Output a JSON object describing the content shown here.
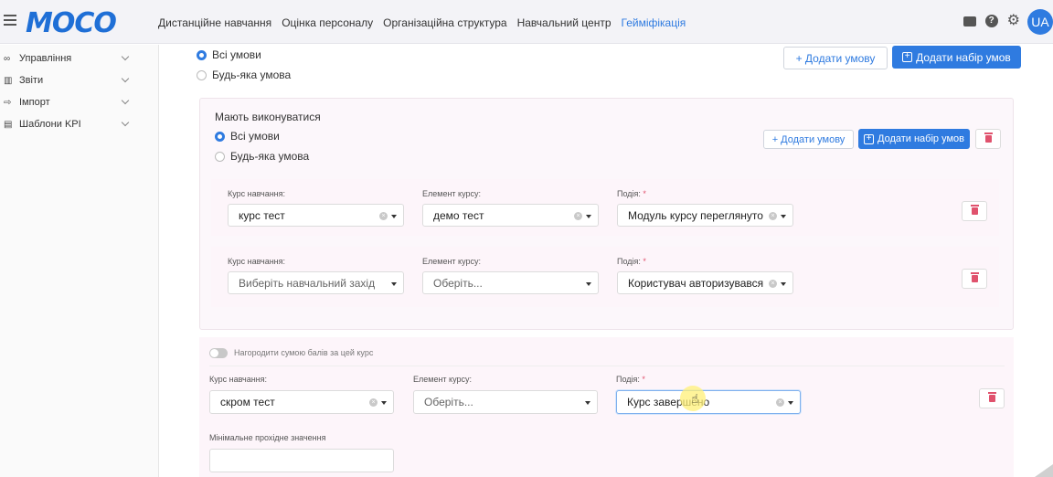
{
  "header": {
    "logo": "MOCO",
    "nav": [
      "Дистанційне навчання",
      "Оцінка персоналу",
      "Організаційна структура",
      "Навчальний центр",
      "Геймiфікація"
    ],
    "nav_active": 4,
    "avatar": "UA"
  },
  "sidebar": {
    "items": [
      {
        "label": "Управління",
        "icon": "glasses-icon"
      },
      {
        "label": "Звіти",
        "icon": "chart-icon"
      },
      {
        "label": "Імпорт",
        "icon": "import-icon"
      },
      {
        "label": "Шаблони KPI",
        "icon": "template-icon"
      }
    ]
  },
  "top": {
    "radio_all": "Всі умови",
    "radio_any": "Будь-яка умова",
    "add_condition": "+ Додати умову",
    "add_set": "Додати набір умов"
  },
  "group": {
    "title": "Мають виконуватися",
    "radio_all": "Всі умови",
    "radio_any": "Будь-яка умова",
    "add_condition": "+ Додати умову",
    "add_set": "Додати набір умов",
    "rows": [
      {
        "course_label": "Курс навчання:",
        "course": "курс тест",
        "element_label": "Елемент курсу:",
        "element": "демо тест",
        "event_label": "Подія:",
        "event": "Модуль курсу переглянуто"
      },
      {
        "course_label": "Курс навчання:",
        "course": "Виберіть навчальний захід",
        "element_label": "Елемент курсу:",
        "element": "Оберіть...",
        "event_label": "Подія:",
        "event": "Користувач авторизувався"
      }
    ]
  },
  "bottom": {
    "toggle_label": "Нагородити сумою балів за цей курс",
    "course_label": "Курс навчання:",
    "course": "скром тест",
    "element_label": "Елемент курсу:",
    "element": "Оберіть...",
    "event_label": "Подія:",
    "event": "Курс завершено",
    "min_label": "Мінімальне прохідне значення",
    "min_value": ""
  },
  "required_mark": "*"
}
